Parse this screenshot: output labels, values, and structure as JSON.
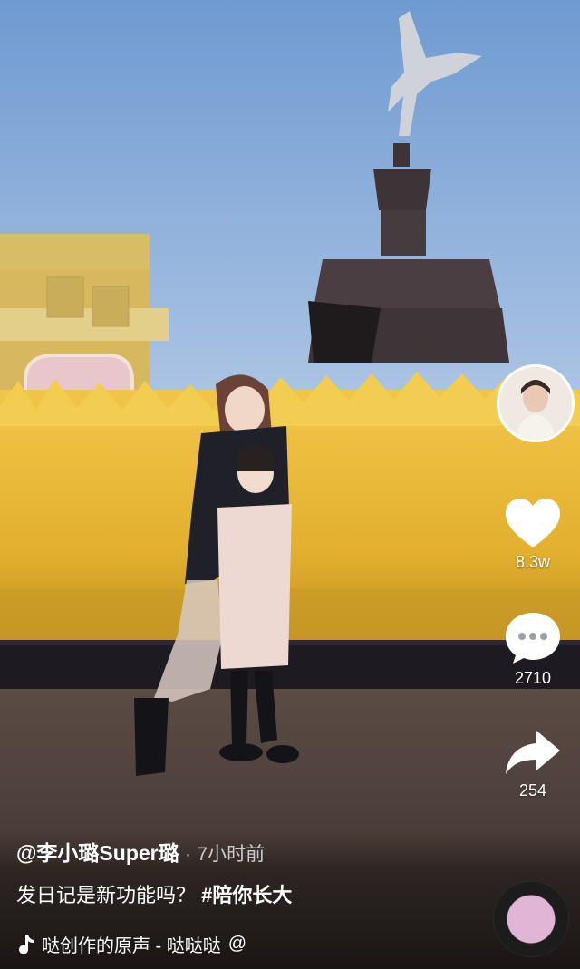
{
  "video": {
    "author": "@李小璐Super璐",
    "separator": "·",
    "time_ago": "7小时前",
    "caption_text": "发日记是新功能吗？",
    "caption_tag": "#陪你长大",
    "music_title": "哒创作的原声 - 哒哒哒",
    "music_at": "@"
  },
  "actions": {
    "likes": "8.3w",
    "comments": "2710",
    "shares": "254"
  },
  "colors": {
    "sky": "#8fb0d9",
    "wheat": "#e8b93a",
    "like_icon": "#ffffff"
  },
  "icons": [
    "music-note-icon",
    "heart-icon",
    "comment-icon",
    "share-icon",
    "music-disc-icon"
  ]
}
